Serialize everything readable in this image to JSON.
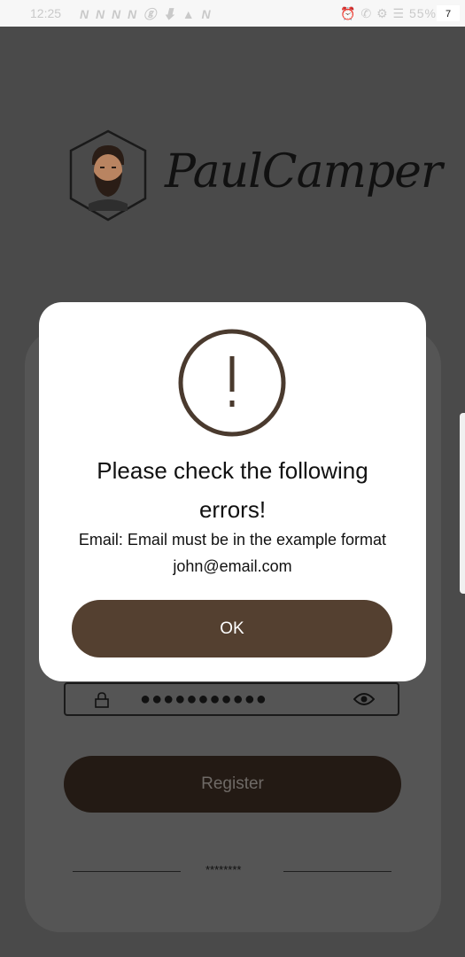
{
  "status_bar": {
    "time": "12:25",
    "notifications": "N N N N ⓖ ⬇ ▲ N",
    "right_indicators": "⏰ ✆ ⚙ ☰ 55%",
    "badge": "7"
  },
  "logo": {
    "wordmark": "PaulCamper",
    "icon": "avatar-badge-icon"
  },
  "form": {
    "password_value": "●●●●●●●●●●●",
    "register_label": "Register",
    "divider_text": "********"
  },
  "dialog": {
    "icon": "exclamation-circle-icon",
    "title": "Please check the following errors!",
    "message": "Email: Email must be in the example format john@email.com",
    "ok_label": "OK"
  },
  "colors": {
    "overlay": "#4a4a4a",
    "accent_brown": "#544030",
    "dark_button": "#231a14"
  }
}
